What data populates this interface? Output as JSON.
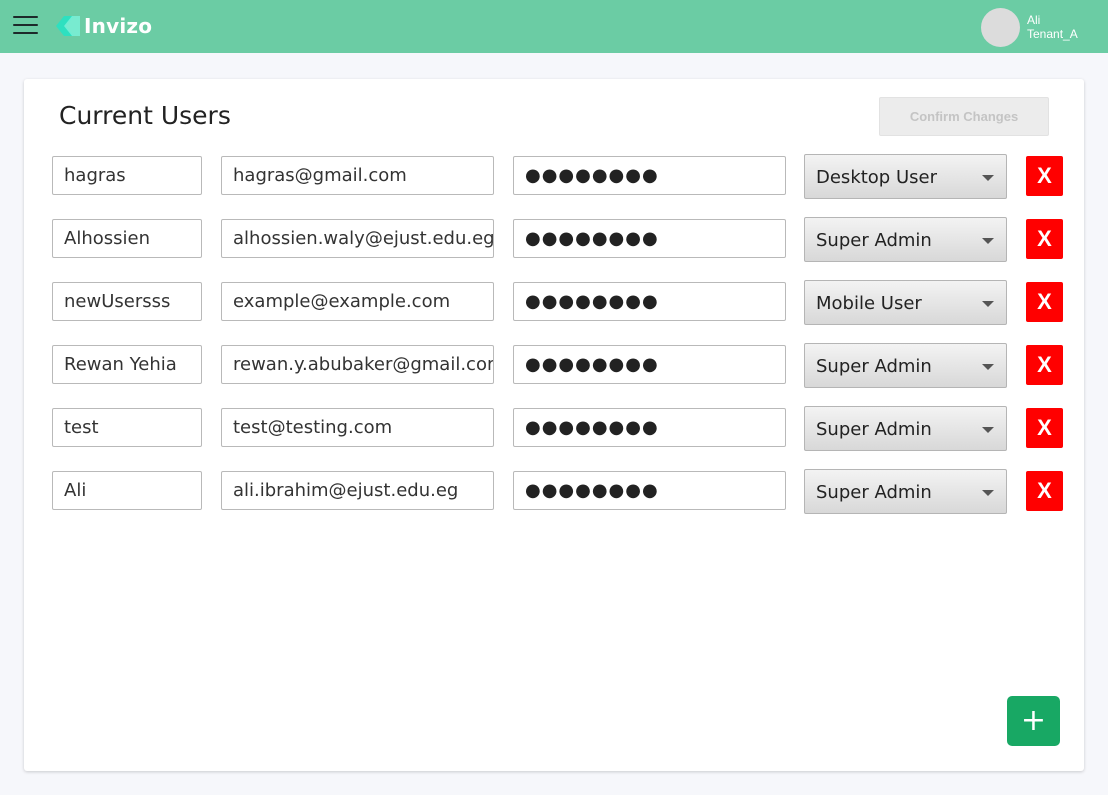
{
  "header": {
    "app_name": "Invizo",
    "user_name": "Ali",
    "tenant": "Tenant_A"
  },
  "main": {
    "title": "Current Users",
    "confirm_label": "Confirm Changes",
    "delete_label": "X",
    "add_label": "+",
    "users": [
      {
        "name": "hagras",
        "email": "hagras@gmail.com",
        "password_mask": "●●●●●●●●",
        "role": "Desktop User"
      },
      {
        "name": "Alhossien",
        "email": "alhossien.waly@ejust.edu.eg",
        "password_mask": "●●●●●●●●",
        "role": "Super Admin"
      },
      {
        "name": "newUsersss",
        "email": "example@example.com",
        "password_mask": "●●●●●●●●",
        "role": "Mobile User"
      },
      {
        "name": "Rewan Yehia",
        "email": "rewan.y.abubaker@gmail.com",
        "password_mask": "●●●●●●●●",
        "role": "Super Admin"
      },
      {
        "name": "test",
        "email": "test@testing.com",
        "password_mask": "●●●●●●●●",
        "role": "Super Admin"
      },
      {
        "name": "Ali",
        "email": "ali.ibrahim@ejust.edu.eg",
        "password_mask": "●●●●●●●●",
        "role": "Super Admin"
      }
    ]
  },
  "colors": {
    "topbar": "#6bcca4",
    "delete": "#ff0000",
    "add": "#18a864"
  },
  "icons": {
    "menu": "hamburger-menu-icon",
    "logo": "invizo-logo-icon",
    "caret": "caret-down-icon"
  }
}
